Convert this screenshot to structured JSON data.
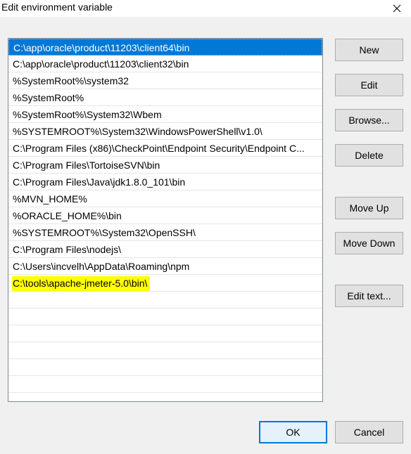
{
  "window": {
    "title": "Edit environment variable",
    "close_icon": "close-icon"
  },
  "paths": [
    "C:\\app\\oracle\\product\\11203\\client64\\bin",
    "C:\\app\\oracle\\product\\11203\\client32\\bin",
    "%SystemRoot%\\system32",
    "%SystemRoot%",
    "%SystemRoot%\\System32\\Wbem",
    "%SYSTEMROOT%\\System32\\WindowsPowerShell\\v1.0\\",
    "C:\\Program Files (x86)\\CheckPoint\\Endpoint Security\\Endpoint C...",
    "C:\\Program Files\\TortoiseSVN\\bin",
    "C:\\Program Files\\Java\\jdk1.8.0_101\\bin",
    "%MVN_HOME%",
    "%ORACLE_HOME%\\bin",
    "%SYSTEMROOT%\\System32\\OpenSSH\\",
    "C:\\Program Files\\nodejs\\",
    "C:\\Users\\incvelh\\AppData\\Roaming\\npm",
    "C:\\tools\\apache-jmeter-5.0\\bin\\"
  ],
  "selected_index": 0,
  "highlighted_index": 14,
  "highlight_color": "#ffff00",
  "selection_color": "#0078d7",
  "buttons": {
    "new": "New",
    "edit": "Edit",
    "browse": "Browse...",
    "delete": "Delete",
    "move_up": "Move Up",
    "move_down": "Move Down",
    "edit_text": "Edit text...",
    "ok": "OK",
    "cancel": "Cancel"
  }
}
